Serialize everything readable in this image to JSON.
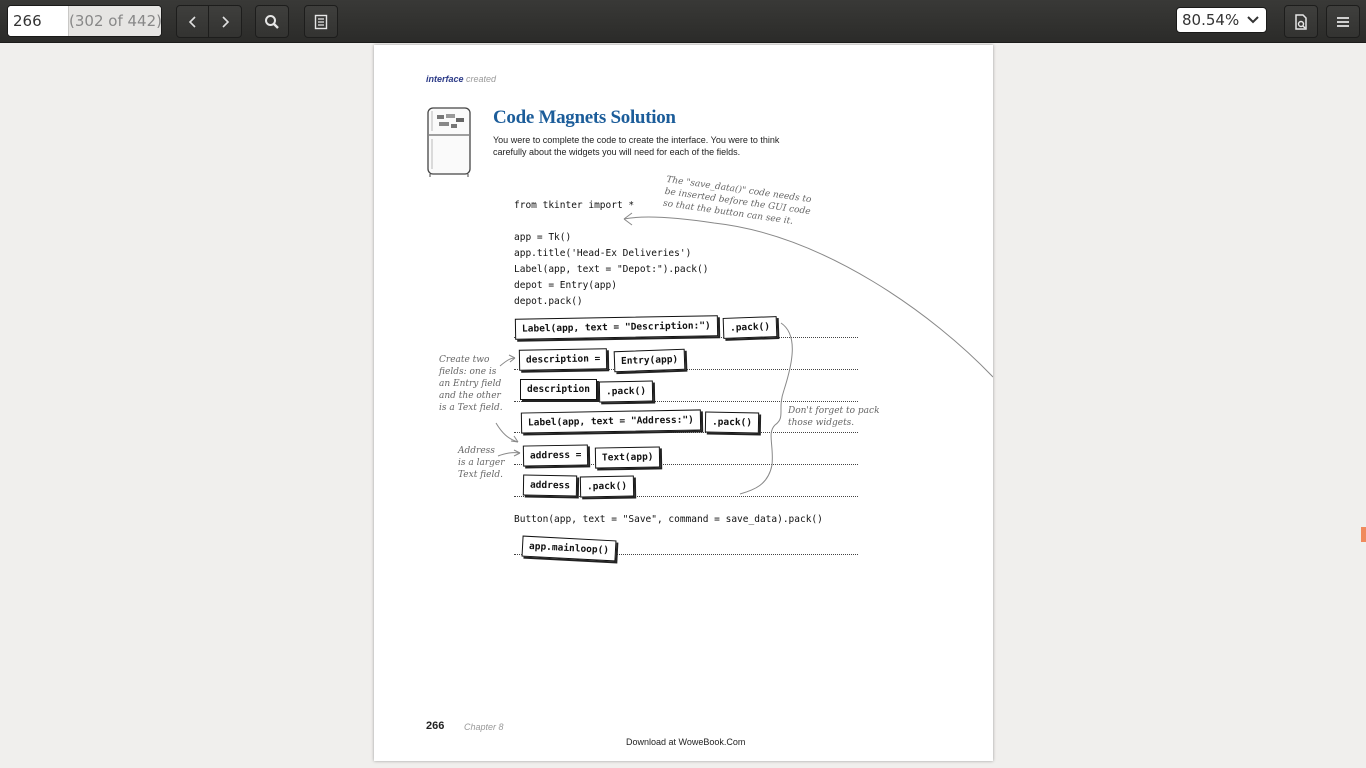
{
  "toolbar": {
    "page_number": "266",
    "page_total": "(302 of 442)",
    "zoom": "80.54%",
    "icons": [
      "chevron-left-icon",
      "chevron-right-icon",
      "search-icon",
      "thumbnails-icon",
      "chevron-down-icon",
      "document-properties-icon",
      "hamburger-menu-icon"
    ]
  },
  "page": {
    "header_bold": "interface",
    "header_rest": "created",
    "title": "Code Magnets Solution",
    "intro": "You were to complete the code to create the interface. You were to think carefully about the widgets you will need for each of the fields.",
    "code": {
      "line1": "from tkinter import *",
      "line2": "app = Tk()",
      "line3": "app.title('Head-Ex Deliveries')",
      "line4": "Label(app, text = \"Depot:\").pack()",
      "line5": "depot = Entry(app)",
      "line6": "depot.pack()",
      "button_line": "Button(app, text = \"Save\", command = save_data).pack()"
    },
    "magnets": {
      "m1": "Label(app, text = \"Description:\")",
      "m2": ".pack()",
      "m3": "description =",
      "m4": "Entry(app)",
      "m5": "description",
      "m6": ".pack()",
      "m7": "Label(app, text = \"Address:\")",
      "m8": ".pack()",
      "m9": "address =",
      "m10": "Text(app)",
      "m11": "address",
      "m12": ".pack()",
      "m13": "app.mainloop()"
    },
    "notes": {
      "save_data": "The \"save_data()\" code needs to\nbe inserted before the GUI code\nso that the button can see it.",
      "two_fields": "Create two\nfields: one is\nan Entry field\nand the other\nis a Text field.",
      "address": "Address\nis a larger\nText field.",
      "pack": "Don't forget to pack\nthose widgets."
    },
    "footer": {
      "page_num": "266",
      "chapter": "Chapter 8",
      "download": "Download at WoweBook.Com"
    }
  },
  "colors": {
    "accent_title": "#1c5d9a",
    "scroll_marker": "#f08a5d"
  }
}
